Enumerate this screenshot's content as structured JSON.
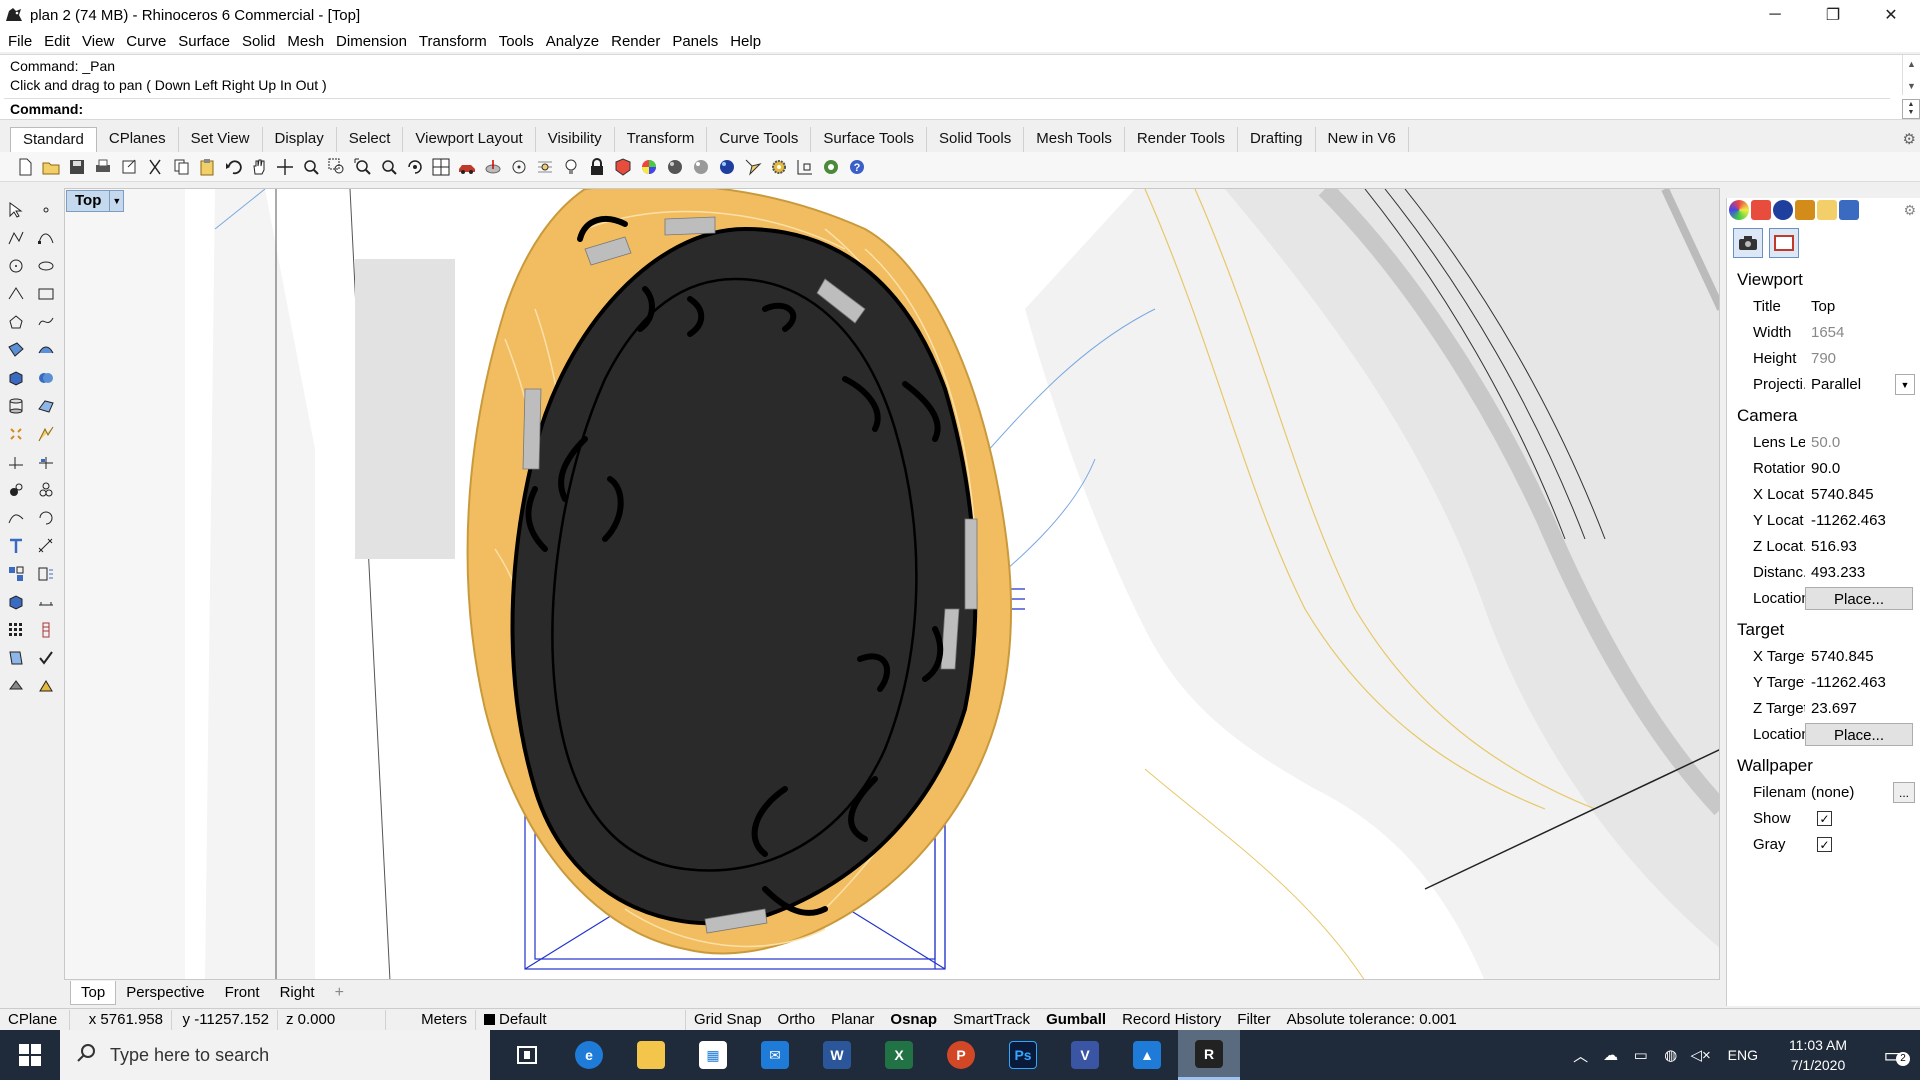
{
  "window": {
    "title": "plan 2 (74 MB) - Rhinoceros 6 Commercial - [Top]",
    "minimize": "─",
    "maximize": "❐",
    "close": "✕"
  },
  "menu": [
    "File",
    "Edit",
    "View",
    "Curve",
    "Surface",
    "Solid",
    "Mesh",
    "Dimension",
    "Transform",
    "Tools",
    "Analyze",
    "Render",
    "Panels",
    "Help"
  ],
  "command": {
    "history_1": "Command: _Pan",
    "history_2": "Click and drag to pan ( Down  Left  Right  Up  In  Out )",
    "prompt": "Command:"
  },
  "toolbar_tabs": [
    "Standard",
    "CPlanes",
    "Set View",
    "Display",
    "Select",
    "Viewport Layout",
    "Visibility",
    "Transform",
    "Curve Tools",
    "Surface Tools",
    "Solid Tools",
    "Mesh Tools",
    "Render Tools",
    "Drafting",
    "New in V6"
  ],
  "active_toolbar_tab": "Standard",
  "viewport": {
    "label": "Top",
    "tabs": [
      "Top",
      "Perspective",
      "Front",
      "Right"
    ],
    "active_tab": "Top",
    "add_tab": "+"
  },
  "properties": {
    "viewport_section": "Viewport",
    "title_label": "Title",
    "title_value": "Top",
    "width_label": "Width",
    "width_value": "1654",
    "height_label": "Height",
    "height_value": "790",
    "projection_label": "Projecti...",
    "projection_value": "Parallel",
    "camera_section": "Camera",
    "lens_label": "Lens Le...",
    "lens_value": "50.0",
    "rotation_label": "Rotation",
    "rotation_value": "90.0",
    "xloc_label": "X Locat...",
    "xloc_value": "5740.845",
    "yloc_label": "Y Locat...",
    "yloc_value": "-11262.463",
    "zloc_label": "Z Locat...",
    "zloc_value": "516.93",
    "dist_label": "Distanc...",
    "dist_value": "493.233",
    "location_label": "Location",
    "place_button": "Place...",
    "target_section": "Target",
    "xtarget_label": "X Target",
    "xtarget_value": "5740.845",
    "ytarget_label": "Y Target",
    "ytarget_value": "-11262.463",
    "ztarget_label": "Z Target",
    "ztarget_value": "23.697",
    "tlocation_label": "Location",
    "tplace_button": "Place...",
    "wallpaper_section": "Wallpaper",
    "filename_label": "Filename",
    "filename_value": "(none)",
    "filename_button": "...",
    "show_label": "Show",
    "show_checked": "✓",
    "gray_label": "Gray",
    "gray_checked": "✓"
  },
  "status": {
    "cplane": "CPlane",
    "x": "x 5761.958",
    "y": "y -11257.152",
    "z": "z 0.000",
    "units": "Meters",
    "layer": "Default",
    "grid_snap": "Grid Snap",
    "ortho": "Ortho",
    "planar": "Planar",
    "osnap": "Osnap",
    "smarttrack": "SmartTrack",
    "gumball": "Gumball",
    "record_history": "Record History",
    "filter": "Filter",
    "tolerance": "Absolute tolerance: 0.001"
  },
  "taskbar": {
    "search_placeholder": "Type here to search",
    "language": "ENG",
    "time": "11:03 AM",
    "date": "7/1/2020",
    "notification_count": "2"
  },
  "colors": {
    "gold": "#f2bd60",
    "dark_fill": "#2a2a2a",
    "blue_lines": "#2233cc",
    "viewport_label_bg": "#c4d8ee"
  }
}
